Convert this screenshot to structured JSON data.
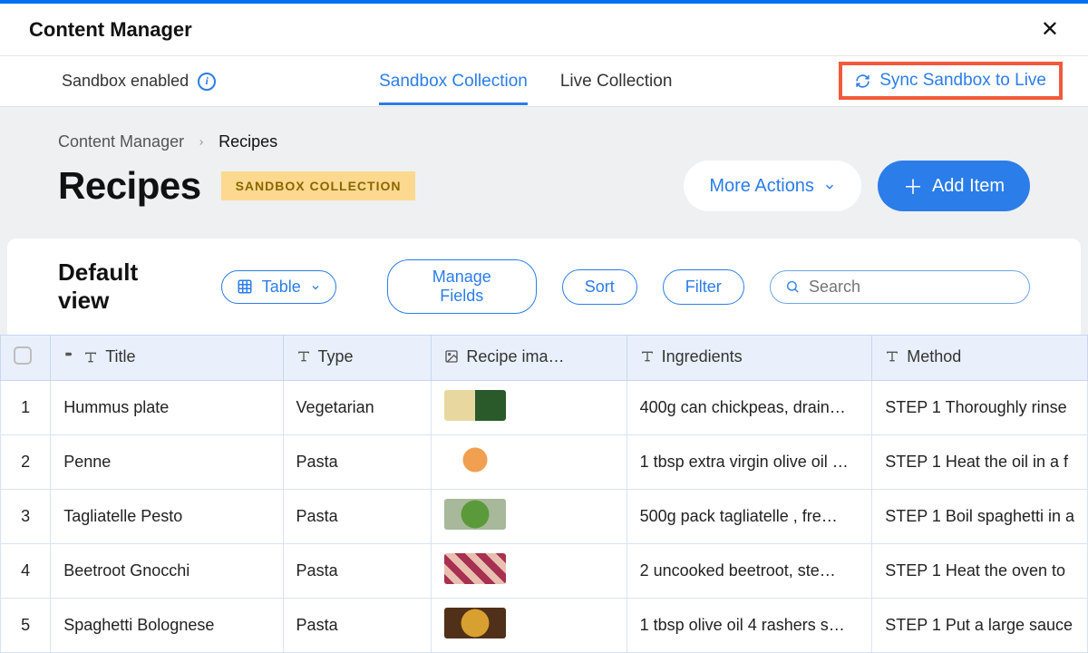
{
  "header": {
    "title": "Content Manager"
  },
  "tabs": {
    "sandbox_label": "Sandbox enabled",
    "items": [
      {
        "label": "Sandbox Collection",
        "active": true
      },
      {
        "label": "Live Collection",
        "active": false
      }
    ],
    "sync_label": "Sync Sandbox to Live"
  },
  "breadcrumb": {
    "root": "Content Manager",
    "current": "Recipes"
  },
  "page": {
    "title": "Recipes",
    "badge": "SANDBOX COLLECTION",
    "more_actions": "More Actions",
    "add_item": "Add Item"
  },
  "view": {
    "title": "Default view",
    "mode": "Table",
    "manage_fields": "Manage Fields",
    "sort": "Sort",
    "filter": "Filter",
    "search_placeholder": "Search"
  },
  "table": {
    "columns": {
      "title": "Title",
      "type": "Type",
      "image": "Recipe ima…",
      "ingredients": "Ingredients",
      "method": "Method"
    },
    "rows": [
      {
        "n": "1",
        "title": "Hummus plate",
        "type": "Vegetarian",
        "thumb": "thumb1",
        "ingredients": "400g can chickpeas, drain…",
        "method": "STEP 1 Thoroughly rinse"
      },
      {
        "n": "2",
        "title": "Penne",
        "type": "Pasta",
        "thumb": "thumb2",
        "ingredients": "1 tbsp extra virgin olive oil …",
        "method": "STEP 1 Heat the oil in a f"
      },
      {
        "n": "3",
        "title": "Tagliatelle Pesto",
        "type": "Pasta",
        "thumb": "thumb3",
        "ingredients": "500g pack tagliatelle , fre…",
        "method": "STEP 1 Boil spaghetti in a"
      },
      {
        "n": "4",
        "title": "Beetroot Gnocchi",
        "type": "Pasta",
        "thumb": "thumb4",
        "ingredients": "2 uncooked beetroot, ste…",
        "method": "STEP 1 Heat the oven to"
      },
      {
        "n": "5",
        "title": "Spaghetti Bolognese",
        "type": "Pasta",
        "thumb": "thumb5",
        "ingredients": "1 tbsp olive oil 4 rashers s…",
        "method": "STEP 1 Put a large sauce"
      }
    ]
  }
}
